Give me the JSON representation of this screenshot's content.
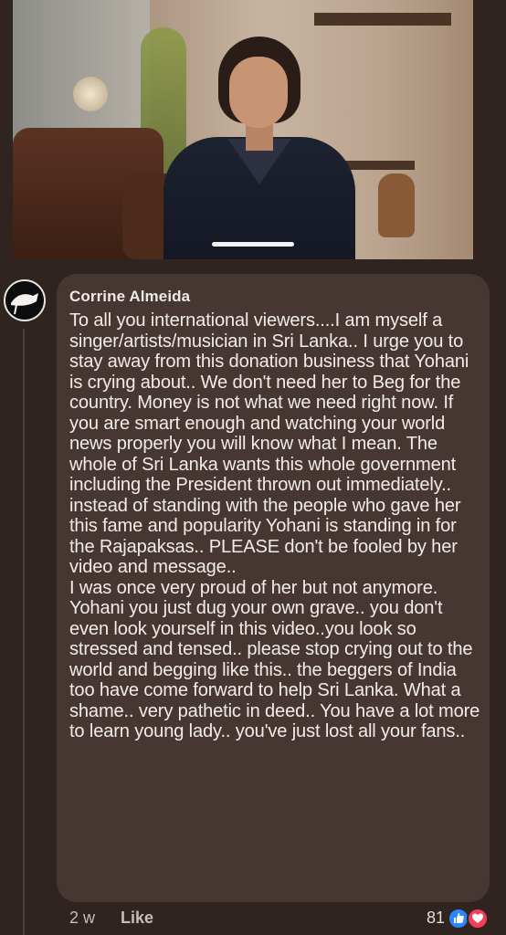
{
  "video": {
    "description_icon": "video-thumbnail"
  },
  "comment": {
    "author": "Corrine Almeida",
    "text": "To all you international viewers....I am myself a singer/artists/musician in Sri Lanka.. I urge you to stay away from this donation business that Yohani is crying about.. We don't need her to Beg for the country. Money is not what we need right now. If you are smart enough and watching your world news properly you will know what I mean. The whole of Sri Lanka wants this whole government including the President thrown out immediately.. instead of standing with the people who gave her this fame and popularity Yohani is  standing in for the Rajapaksas.. PLEASE don't be fooled by her video and message..\nI was once very proud of her but not anymore. Yohani you just dug your own grave.. you don't even look yourself in this video..you look so stressed and tensed.. please stop crying out to the world and begging like this.. the beggers of India too have come forward to help Sri Lanka. What a shame.. very pathetic in deed.. You have a lot more to learn young lady.. you've just lost all your fans..",
    "time": "2 w",
    "like_label": "Like",
    "reaction_count": "81",
    "reactions": [
      "like-icon",
      "love-icon"
    ]
  },
  "colors": {
    "background": "#2f2420",
    "bubble": "#463732",
    "like_blue": "#2d86ff",
    "love_red": "#f33e58"
  }
}
